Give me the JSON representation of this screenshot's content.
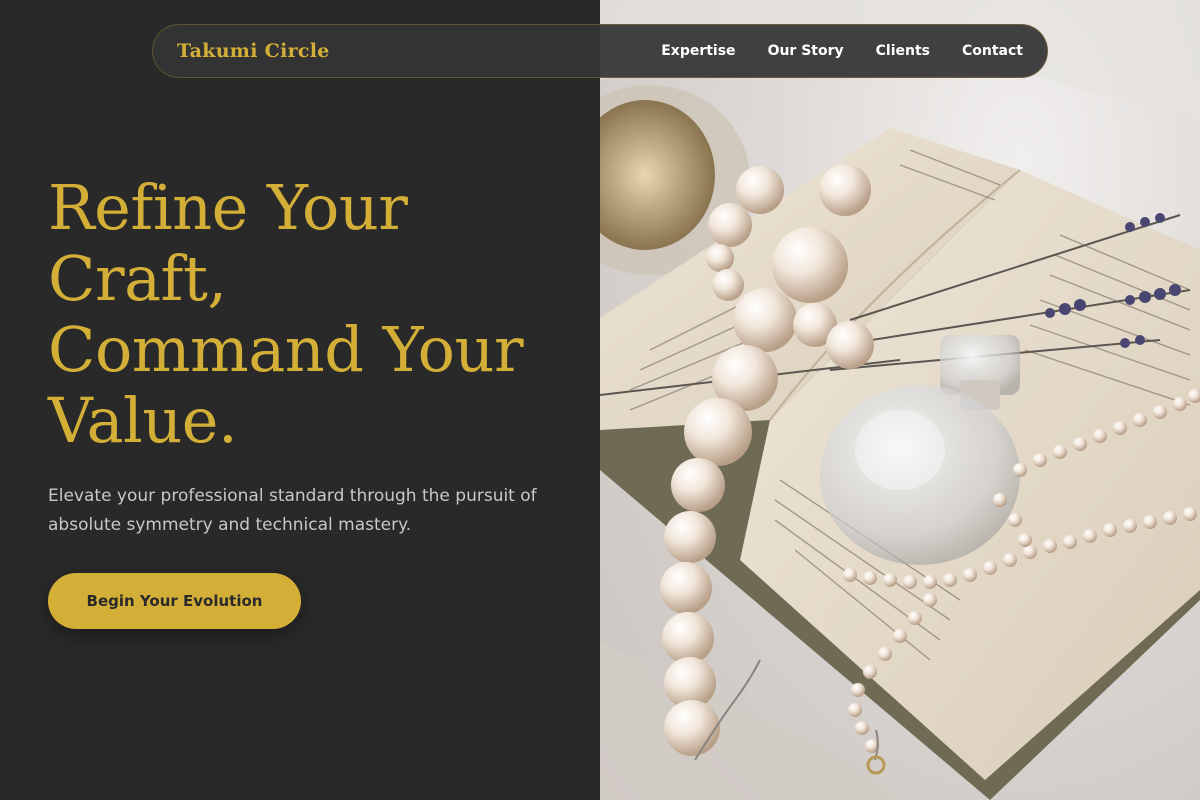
{
  "brand": {
    "name": "Takumi Circle"
  },
  "nav": {
    "links": [
      {
        "label": "Expertise"
      },
      {
        "label": "Our Story"
      },
      {
        "label": "Clients"
      },
      {
        "label": "Contact"
      }
    ]
  },
  "hero": {
    "headline_lines": [
      "Refine Your",
      "Craft,",
      "Command Your",
      "Value."
    ],
    "subtext": "Elevate your professional standard through the pursuit of absolute symmetry and technical mastery.",
    "cta_label": "Begin Your Evolution"
  },
  "colors": {
    "accent": "#d4af37",
    "background": "#292929",
    "text_light": "#c8c8c8",
    "nav_text": "#ffffff"
  }
}
